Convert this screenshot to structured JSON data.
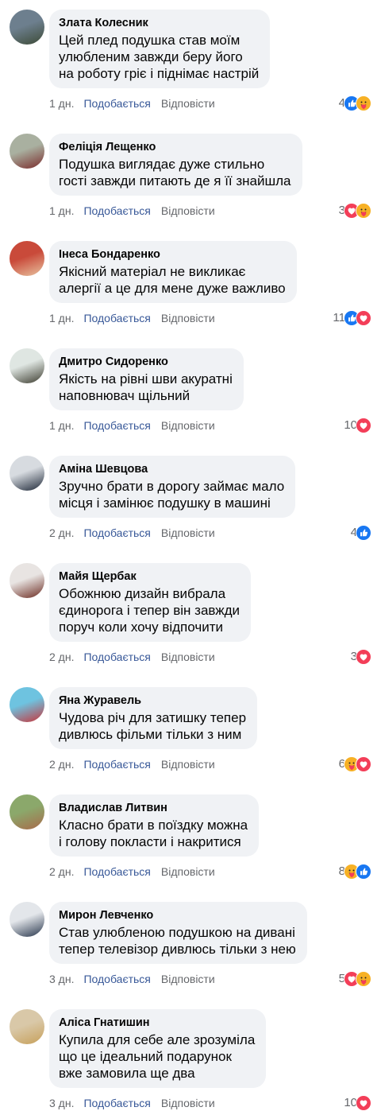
{
  "comments": [
    {
      "author": "Злата Колесник",
      "lines": [
        "Цей плед подушка став моїм",
        "улюбленим завжди беру його",
        "на роботу гріє і піднімає настрій"
      ],
      "time": "1 дн.",
      "like_label": "Подобається",
      "reply_label": "Відповісти",
      "reactions_count": "4",
      "reactions": [
        "like-icon",
        "care-icon"
      ],
      "avatar_colors": [
        "#6d7f8e",
        "#3c4a36"
      ]
    },
    {
      "author": "Феліція Лещенко",
      "lines": [
        "Подушка виглядає дуже стильно",
        "гості завжди питають де я її знайшла"
      ],
      "time": "1 дн.",
      "like_label": "Подобається",
      "reply_label": "Відповісти",
      "reactions_count": "3",
      "reactions": [
        "love-icon",
        "care-icon"
      ],
      "avatar_colors": [
        "#a9b0a0",
        "#7a2b2b"
      ]
    },
    {
      "author": "Інеса Бондаренко",
      "lines": [
        "Якісний матеріал не викликає",
        "алергії а це для мене дуже важливо"
      ],
      "time": "1 дн.",
      "like_label": "Подобається",
      "reply_label": "Відповісти",
      "reactions_count": "11",
      "reactions": [
        "like-icon",
        "love-icon"
      ],
      "avatar_colors": [
        "#c94a3a",
        "#e8c3a0"
      ]
    },
    {
      "author": "Дмитро Сидоренко",
      "lines": [
        "Якість на рівні шви акуратні",
        "наповнювач щільний"
      ],
      "time": "1 дн.",
      "like_label": "Подобається",
      "reply_label": "Відповісти",
      "reactions_count": "10",
      "reactions": [
        "love-icon"
      ],
      "avatar_colors": [
        "#dfe6e2",
        "#3b3b2e"
      ]
    },
    {
      "author": "Аміна Шевцова",
      "lines": [
        "Зручно брати в дорогу займає мало",
        "місця і замінює подушку в машині"
      ],
      "time": "2 дн.",
      "like_label": "Подобається",
      "reply_label": "Відповісти",
      "reactions_count": "4",
      "reactions": [
        "like-icon"
      ],
      "avatar_colors": [
        "#d7dbe0",
        "#1c2636"
      ]
    },
    {
      "author": "Майя Щербак",
      "lines": [
        "Обожнюю дизайн вибрала",
        "єдинорога і тепер він завжди",
        "поруч коли хочу відпочити"
      ],
      "time": "2 дн.",
      "like_label": "Подобається",
      "reply_label": "Відповісти",
      "reactions_count": "3",
      "reactions": [
        "love-icon"
      ],
      "avatar_colors": [
        "#e8e4e2",
        "#6b2a20"
      ]
    },
    {
      "author": "Яна Журавель",
      "lines": [
        "Чудова річ для затишку тепер",
        "дивлюсь фільми тільки з ним"
      ],
      "time": "2 дн.",
      "like_label": "Подобається",
      "reply_label": "Відповісти",
      "reactions_count": "6",
      "reactions": [
        "care-icon",
        "love-icon"
      ],
      "avatar_colors": [
        "#6ec3e0",
        "#c8343a"
      ]
    },
    {
      "author": "Владислав Литвин",
      "lines": [
        "Класно брати в поїздку можна",
        "і голову покласти і накритися"
      ],
      "time": "2 дн.",
      "like_label": "Подобається",
      "reply_label": "Відповісти",
      "reactions_count": "8",
      "reactions": [
        "care-icon",
        "like-icon"
      ],
      "avatar_colors": [
        "#8ba86b",
        "#a86a4a"
      ]
    },
    {
      "author": "Мирон Левченко",
      "lines": [
        "Став улюбленою подушкою на дивані",
        "тепер телевізор дивлюсь тільки з нею"
      ],
      "time": "3 дн.",
      "like_label": "Подобається",
      "reply_label": "Відповісти",
      "reactions_count": "5",
      "reactions": [
        "love-icon",
        "care-icon"
      ],
      "avatar_colors": [
        "#e3e6ea",
        "#26344a"
      ]
    },
    {
      "author": "Аліса Гнатишин",
      "lines": [
        "Купила для себе але зрозуміла",
        "що це ідеальний подарунок",
        "вже замовила ще два"
      ],
      "time": "3 дн.",
      "like_label": "Подобається",
      "reply_label": "Відповісти",
      "reactions_count": "10",
      "reactions": [
        "love-icon"
      ],
      "avatar_colors": [
        "#d9c8a8",
        "#c7a05a"
      ]
    }
  ],
  "colors": {
    "bubble": "#f0f2f5",
    "like_link": "#385898",
    "meta": "#65676b",
    "like_blue": "#1877f2",
    "love_red": "#f33e58",
    "care_yellow": "#f7b125"
  }
}
